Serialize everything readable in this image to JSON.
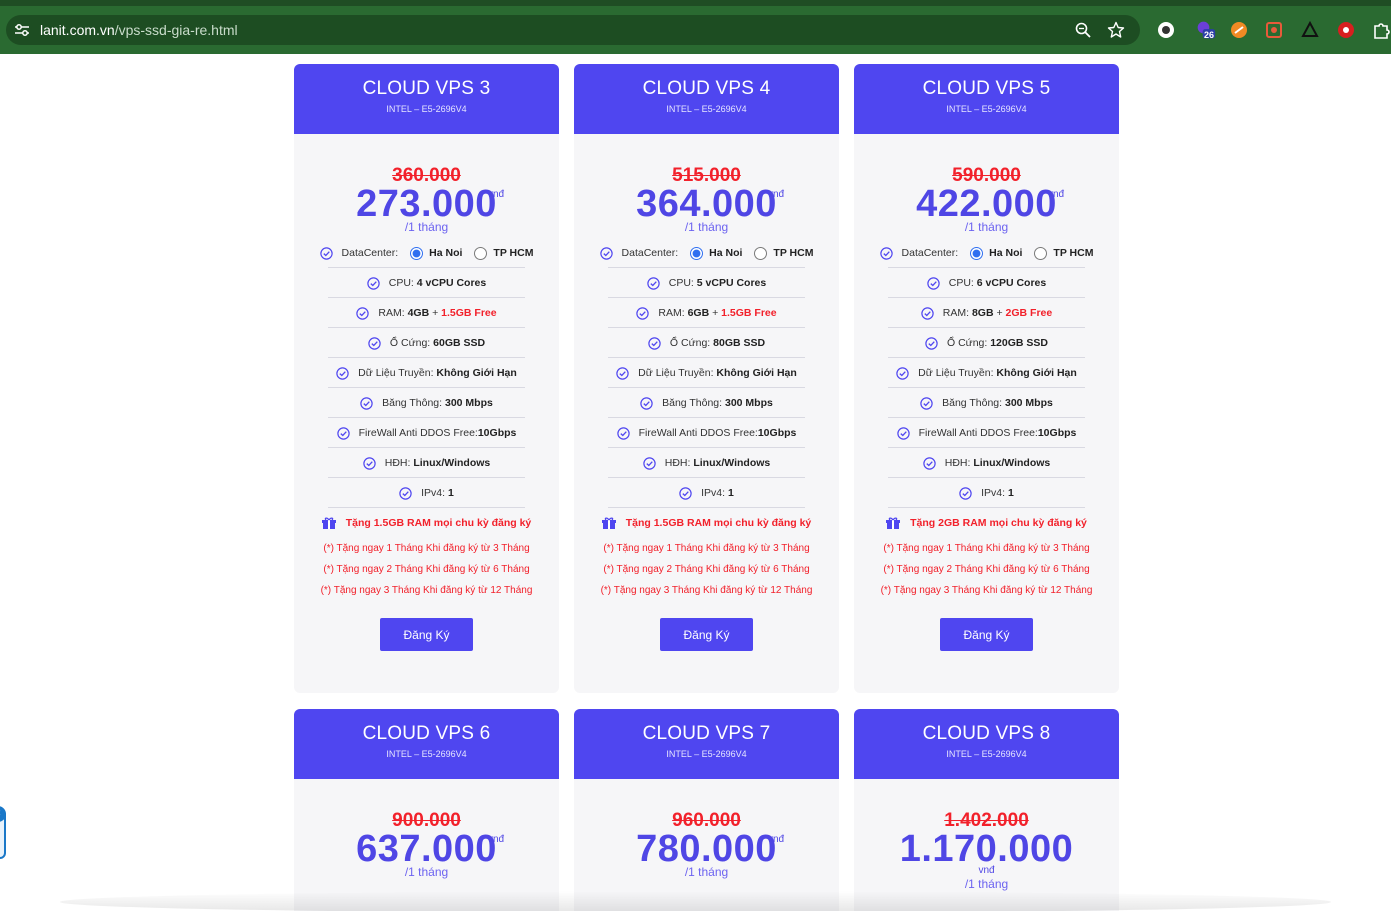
{
  "browser": {
    "url_domain": "lanit.com.vn",
    "url_path": "/vps-ssd-gia-re.html",
    "badge_count": "26"
  },
  "plans": [
    {
      "title": "CLOUD VPS 3",
      "subtitle": "INTEL – E5-2696V4",
      "old_price": "360.000",
      "price": "273.000",
      "unit": "vnđ",
      "period": "/1 tháng",
      "datacenter_label": "DataCenter:",
      "dc_option1": "Ha Noi",
      "dc_option2": "TP HCM",
      "dc_selected": "Ha Noi",
      "cpu_label": "CPU: ",
      "cpu_value": "4 vCPU Cores",
      "ram_label": "RAM: ",
      "ram_value": "4GB",
      "ram_plus": " + ",
      "ram_free": "1.5GB Free",
      "disk_label": "Ổ Cứng: ",
      "disk_value": "60GB SSD",
      "transfer_label": "Dữ Liệu Truyền: ",
      "transfer_value": "Không Giới Hạn",
      "bandwidth_label": "Băng Thông: ",
      "bandwidth_value": "300 Mbps",
      "firewall_label": "FireWall Anti DDOS Free: ",
      "firewall_value": "10Gbps",
      "os_label": "HĐH: ",
      "os_value": "Linux/Windows",
      "ipv4_label": "IPv4: ",
      "ipv4_value": "1",
      "gift": "Tặng 1.5GB RAM mọi chu kỳ đăng ký",
      "promos": [
        "(*) Tặng ngay 1 Tháng Khi đăng ký từ 3 Tháng",
        "(*) Tặng ngay 2 Tháng Khi đăng ký từ 6 Tháng",
        "(*) Tặng ngay 3 Tháng Khi đăng ký từ 12 Tháng"
      ],
      "button": "Đăng Ký"
    },
    {
      "title": "CLOUD VPS 4",
      "subtitle": "INTEL – E5-2696V4",
      "old_price": "515.000",
      "price": "364.000",
      "unit": "vnđ",
      "period": "/1 tháng",
      "datacenter_label": "DataCenter:",
      "dc_option1": "Ha Noi",
      "dc_option2": "TP HCM",
      "dc_selected": "Ha Noi",
      "cpu_label": "CPU: ",
      "cpu_value": "5 vCPU Cores",
      "ram_label": "RAM: ",
      "ram_value": "6GB",
      "ram_plus": " + ",
      "ram_free": "1.5GB Free",
      "disk_label": "Ổ Cứng: ",
      "disk_value": "80GB SSD",
      "transfer_label": "Dữ Liệu Truyền: ",
      "transfer_value": "Không Giới Hạn",
      "bandwidth_label": "Băng Thông: ",
      "bandwidth_value": "300 Mbps",
      "firewall_label": "FireWall Anti DDOS Free: ",
      "firewall_value": "10Gbps",
      "os_label": "HĐH: ",
      "os_value": "Linux/Windows",
      "ipv4_label": "IPv4: ",
      "ipv4_value": "1",
      "gift": "Tặng 1.5GB RAM mọi chu kỳ đăng ký",
      "promos": [
        "(*) Tặng ngay 1 Tháng Khi đăng ký từ 3 Tháng",
        "(*) Tặng ngay 2 Tháng Khi đăng ký từ 6 Tháng",
        "(*) Tặng ngay 3 Tháng Khi đăng ký từ 12 Tháng"
      ],
      "button": "Đăng Ký"
    },
    {
      "title": "CLOUD VPS 5",
      "subtitle": "INTEL – E5-2696V4",
      "old_price": "590.000",
      "price": "422.000",
      "unit": "vnđ",
      "period": "/1 tháng",
      "datacenter_label": "DataCenter:",
      "dc_option1": "Ha Noi",
      "dc_option2": "TP HCM",
      "dc_selected": "Ha Noi",
      "cpu_label": "CPU: ",
      "cpu_value": "6 vCPU Cores",
      "ram_label": "RAM: ",
      "ram_value": "8GB",
      "ram_plus": " + ",
      "ram_free": "2GB Free",
      "disk_label": "Ổ Cứng: ",
      "disk_value": "120GB SSD",
      "transfer_label": "Dữ Liệu Truyền: ",
      "transfer_value": "Không Giới Hạn",
      "bandwidth_label": "Băng Thông: ",
      "bandwidth_value": "300 Mbps",
      "firewall_label": "FireWall Anti DDOS Free: ",
      "firewall_value": "10Gbps",
      "os_label": "HĐH: ",
      "os_value": "Linux/Windows",
      "ipv4_label": "IPv4: ",
      "ipv4_value": "1",
      "gift": "Tặng 2GB RAM mọi chu kỳ đăng ký",
      "promos": [
        "(*) Tặng ngay 1 Tháng Khi đăng ký từ 3 Tháng",
        "(*) Tặng ngay 2 Tháng Khi đăng ký từ 6 Tháng",
        "(*) Tặng ngay 3 Tháng Khi đăng ký từ 12 Tháng"
      ],
      "button": "Đăng Ký"
    }
  ],
  "plans_row2": [
    {
      "title": "CLOUD VPS 6",
      "subtitle": "INTEL – E5-2696V4",
      "old_price": "900.000",
      "price": "637.000",
      "unit": "vnđ",
      "period": "/1 tháng"
    },
    {
      "title": "CLOUD VPS 7",
      "subtitle": "INTEL – E5-2696V4",
      "old_price": "960.000",
      "price": "780.000",
      "unit": "vnđ",
      "period": "/1 tháng"
    },
    {
      "title": "CLOUD VPS 8",
      "subtitle": "INTEL – E5-2696V4",
      "old_price": "1.402.000",
      "price": "1.170.000",
      "unit": "vnđ",
      "period": "/1 tháng"
    }
  ],
  "colors": {
    "accent": "#4f46f0",
    "sale_red": "#f2212b",
    "chrome_green": "#2a6a31"
  }
}
